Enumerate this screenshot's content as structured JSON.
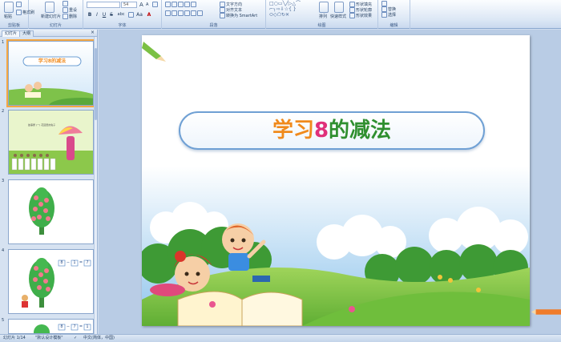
{
  "ribbon": {
    "clipboard": {
      "paste_label": "粘贴",
      "cut_label": "剪切",
      "format_painter_label": "格式刷",
      "group_label": "剪贴板"
    },
    "slides": {
      "new_slide_label": "新建幻灯片",
      "layout_label": "版式",
      "reset_label": "重设",
      "delete_label": "删除",
      "group_label": "幻灯片"
    },
    "font": {
      "font_size": "54",
      "group_label": "字体",
      "bold": "B",
      "italic": "I",
      "underline": "U",
      "strike": "S",
      "shadow": "abc",
      "size_up": "A",
      "size_down": "A"
    },
    "paragraph": {
      "text_direction_label": "文字方向",
      "align_text_label": "对齐文本",
      "smartart_label": "转换为 SmartArt",
      "group_label": "段落"
    },
    "drawing": {
      "arrange_label": "排列",
      "quick_styles_label": "快速样式",
      "shape_fill_label": "形状填充",
      "shape_outline_label": "形状轮廓",
      "shape_effects_label": "形状效果",
      "group_label": "绘图"
    },
    "editing": {
      "find_label": "查找",
      "replace_label": "替换",
      "select_label": "选择",
      "group_label": "编辑"
    }
  },
  "pane": {
    "tab_slides": "幻灯片",
    "tab_outline": "大纲",
    "close": "×",
    "thumbnails": [
      {
        "number": "1",
        "title": "学习8的减法"
      },
      {
        "number": "2",
        "caption": "故事屋 (一) 花园里的兔子"
      },
      {
        "number": "3"
      },
      {
        "number": "4",
        "expr_a": "8",
        "expr_op": "−",
        "expr_b": "1",
        "expr_eq": "=",
        "expr_c": "7"
      },
      {
        "number": "5",
        "expr_a": "8",
        "expr_op": "−",
        "expr_b": "7",
        "expr_eq": "=",
        "expr_c": "1"
      }
    ]
  },
  "slide": {
    "title_part1": "学习",
    "title_part2": "8",
    "title_part3": "的减法"
  },
  "status": {
    "slide_counter": "幻灯片 1/14",
    "theme": "\"默认设计模板\"",
    "language": "中文(简体，中国)"
  },
  "colors": {
    "accent_orange": "#f08a1c",
    "accent_pink": "#e0307a",
    "accent_green": "#2f8f2f",
    "selection": "#f5a742"
  }
}
